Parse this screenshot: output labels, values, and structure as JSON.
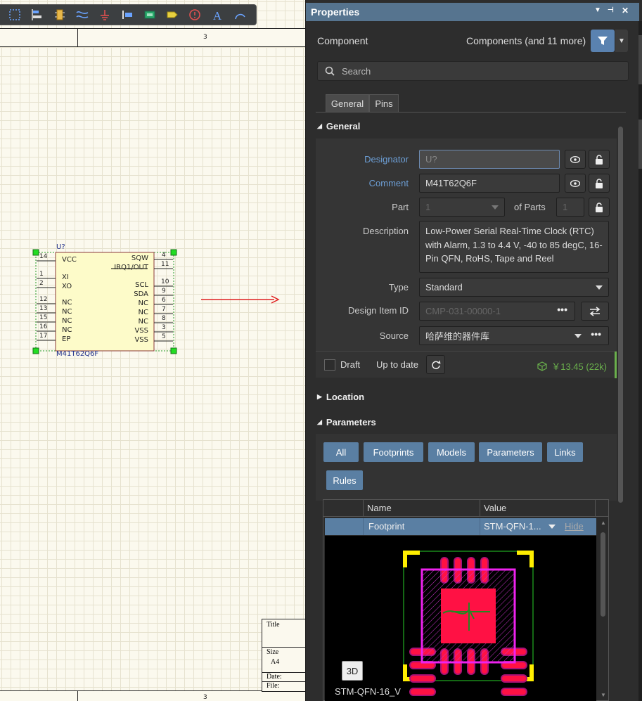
{
  "canvas": {
    "zone_top": "3",
    "zone_bottom": "3",
    "titleblock": {
      "title": "Title",
      "size": "Size",
      "size_value": "A4",
      "date": "Date:",
      "file": "File:"
    },
    "symbol": {
      "designator": "U?",
      "part_name": "M41T62Q6F",
      "left_pins": [
        {
          "num": "14",
          "name": "VCC"
        },
        {
          "num": "1",
          "name": "XI"
        },
        {
          "num": "2",
          "name": "XO"
        },
        {
          "num": "12",
          "name": "NC"
        },
        {
          "num": "13",
          "name": "NC"
        },
        {
          "num": "15",
          "name": "NC"
        },
        {
          "num": "16",
          "name": "NC"
        },
        {
          "num": "17",
          "name": "EP"
        }
      ],
      "right_pins": [
        {
          "num": "4",
          "name": "SQW"
        },
        {
          "num": "11",
          "name": "IRQ1/OUT"
        },
        {
          "num": "10",
          "name": "SCL"
        },
        {
          "num": "9",
          "name": "SDA"
        },
        {
          "num": "6",
          "name": "NC"
        },
        {
          "num": "7",
          "name": "NC"
        },
        {
          "num": "8",
          "name": "NC"
        },
        {
          "num": "3",
          "name": "VSS"
        },
        {
          "num": "5",
          "name": "VSS"
        }
      ]
    }
  },
  "toolbar": {
    "tools": [
      "select-area-icon",
      "align-icon",
      "part-icon",
      "wire-icon",
      "ground-icon",
      "bus-icon",
      "net-label-icon",
      "port-icon",
      "no-erc-icon",
      "text-icon",
      "arc-icon"
    ]
  },
  "panel": {
    "title": "Properties",
    "object_type": "Component",
    "selection_summary": "Components (and 11 more)",
    "search_placeholder": "Search",
    "tabs": [
      "General",
      "Pins"
    ],
    "sections": {
      "general": "General",
      "location": "Location",
      "parameters": "Parameters"
    },
    "general": {
      "designator_label": "Designator",
      "designator_value": "U?",
      "comment_label": "Comment",
      "comment_value": "M41T62Q6F",
      "part_label": "Part",
      "part_value": "1",
      "of_parts_label": "of Parts",
      "of_parts_value": "1",
      "description_label": "Description",
      "description_value": "Low-Power Serial Real-Time Clock (RTC) with Alarm, 1.3 to 4.4 V, -40 to 85 degC, 16-Pin QFN, RoHS, Tape and Reel",
      "type_label": "Type",
      "type_value": "Standard",
      "design_item_label": "Design Item ID",
      "design_item_value": "CMP-031-00000-1",
      "source_label": "Source",
      "source_value": "哈萨维的器件库",
      "draft_label": "Draft",
      "up_to_date_label": "Up to date",
      "price": "￥13.45 (22k)"
    },
    "parameters": {
      "filter_buttons": [
        "All",
        "Footprints",
        "Models",
        "Parameters",
        "Links",
        "Rules"
      ],
      "columns": [
        "Name",
        "Value"
      ],
      "row": {
        "name": "Footprint",
        "value": "STM-QFN-1...",
        "hide": "Hide"
      },
      "preview_button": "3D",
      "footprint_name": "STM-QFN-16_V"
    },
    "colors": {
      "title_bar": "#56748f",
      "accent_button": "#5a7fa3",
      "price_green": "#6ab04c",
      "link_blue": "#6d9fd6"
    }
  }
}
